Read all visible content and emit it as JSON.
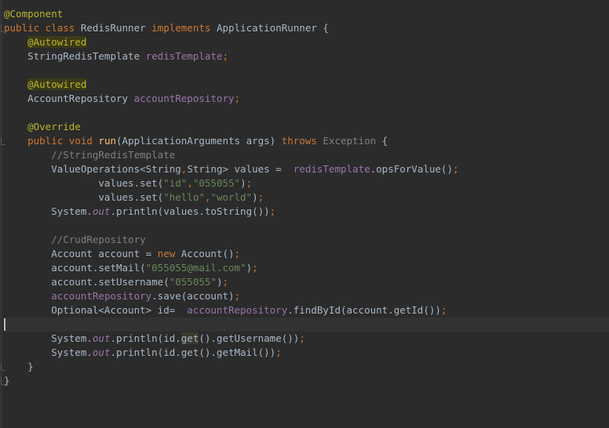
{
  "lines": [
    [
      {
        "t": "@Component",
        "c": "ann"
      }
    ],
    [
      {
        "t": "public class ",
        "c": "kw"
      },
      {
        "t": "RedisRunner ",
        "c": "pl"
      },
      {
        "t": "implements ",
        "c": "kw"
      },
      {
        "t": "ApplicationRunner {",
        "c": "pl"
      }
    ],
    [
      {
        "t": "    ",
        "c": "pl"
      },
      {
        "t": "@Autowired",
        "c": "ann-hl"
      }
    ],
    [
      {
        "t": "    StringRedisTemplate ",
        "c": "pl"
      },
      {
        "t": "redisTemplate",
        "c": "field"
      },
      {
        "t": ";",
        "c": "kw"
      }
    ],
    [],
    [
      {
        "t": "    ",
        "c": "pl"
      },
      {
        "t": "@Autowired",
        "c": "ann-hl"
      }
    ],
    [
      {
        "t": "    AccountRepository ",
        "c": "pl"
      },
      {
        "t": "accountRepository",
        "c": "field"
      },
      {
        "t": ";",
        "c": "kw"
      }
    ],
    [],
    [
      {
        "t": "    ",
        "c": "pl"
      },
      {
        "t": "@Override",
        "c": "ann"
      }
    ],
    [
      {
        "t": "    ",
        "c": "pl"
      },
      {
        "t": "public void ",
        "c": "kw"
      },
      {
        "t": "run",
        "c": "method"
      },
      {
        "t": "(ApplicationArguments args) ",
        "c": "pl"
      },
      {
        "t": "throws ",
        "c": "kw"
      },
      {
        "t": "Exception ",
        "c": "exc"
      },
      {
        "t": "{",
        "c": "pl"
      }
    ],
    [
      {
        "t": "        //StringRedisTemplate",
        "c": "cm"
      }
    ],
    [
      {
        "t": "        ValueOperations<String",
        "c": "pl"
      },
      {
        "t": ",",
        "c": "kw"
      },
      {
        "t": "String> values =  ",
        "c": "pl"
      },
      {
        "t": "redisTemplate",
        "c": "field"
      },
      {
        "t": ".opsForValue()",
        "c": "pl"
      },
      {
        "t": ";",
        "c": "kw"
      }
    ],
    [
      {
        "t": "                values.set(",
        "c": "pl"
      },
      {
        "t": "\"id\"",
        "c": "str"
      },
      {
        "t": ",",
        "c": "kw"
      },
      {
        "t": "\"055055\"",
        "c": "str"
      },
      {
        "t": ")",
        "c": "pl"
      },
      {
        "t": ";",
        "c": "kw"
      }
    ],
    [
      {
        "t": "                values.set(",
        "c": "pl"
      },
      {
        "t": "\"hello\"",
        "c": "str"
      },
      {
        "t": ",",
        "c": "kw"
      },
      {
        "t": "\"world\"",
        "c": "str"
      },
      {
        "t": ")",
        "c": "pl"
      },
      {
        "t": ";",
        "c": "kw"
      }
    ],
    [
      {
        "t": "        System.",
        "c": "pl"
      },
      {
        "t": "out",
        "c": "static"
      },
      {
        "t": ".println(values.toString())",
        "c": "pl"
      },
      {
        "t": ";",
        "c": "kw"
      }
    ],
    [],
    [
      {
        "t": "        //CrudRepository",
        "c": "cm"
      }
    ],
    [
      {
        "t": "        Account account = ",
        "c": "pl"
      },
      {
        "t": "new ",
        "c": "kw"
      },
      {
        "t": "Account()",
        "c": "pl"
      },
      {
        "t": ";",
        "c": "kw"
      }
    ],
    [
      {
        "t": "        account.setMail(",
        "c": "pl"
      },
      {
        "t": "\"055055@mail.com\"",
        "c": "str"
      },
      {
        "t": ")",
        "c": "pl"
      },
      {
        "t": ";",
        "c": "kw"
      }
    ],
    [
      {
        "t": "        account.setUsername(",
        "c": "pl"
      },
      {
        "t": "\"055055\"",
        "c": "str"
      },
      {
        "t": ")",
        "c": "pl"
      },
      {
        "t": ";",
        "c": "kw"
      }
    ],
    [
      {
        "t": "        ",
        "c": "pl"
      },
      {
        "t": "accountRepository",
        "c": "field"
      },
      {
        "t": ".save(account)",
        "c": "pl"
      },
      {
        "t": ";",
        "c": "kw"
      }
    ],
    [
      {
        "t": "        Optional<Account> id=  ",
        "c": "pl"
      },
      {
        "t": "accountRepository",
        "c": "field"
      },
      {
        "t": ".findById(account.getId())",
        "c": "pl"
      },
      {
        "t": ";",
        "c": "kw"
      }
    ],
    [],
    [
      {
        "t": "        System.",
        "c": "pl"
      },
      {
        "t": "out",
        "c": "static"
      },
      {
        "t": ".println(id.",
        "c": "pl"
      },
      {
        "t": "get",
        "c": "sel"
      },
      {
        "t": "().getUsername())",
        "c": "pl"
      },
      {
        "t": ";",
        "c": "kw"
      }
    ],
    [
      {
        "t": "        System.",
        "c": "pl"
      },
      {
        "t": "out",
        "c": "static"
      },
      {
        "t": ".println(id.get().getMail())",
        "c": "pl"
      },
      {
        "t": ";",
        "c": "kw"
      }
    ],
    [
      {
        "t": "    }",
        "c": "pl"
      }
    ],
    [
      {
        "t": "}",
        "c": "pl"
      }
    ]
  ],
  "current_line": 22,
  "colors": {
    "background": "#2b2b2b",
    "current_line": "#323232",
    "keyword": "#cc7832",
    "annotation": "#bbb529",
    "field": "#9876aa",
    "string": "#6a8759",
    "comment": "#808080",
    "method": "#ffc66d",
    "plain": "#a9b7c6"
  }
}
